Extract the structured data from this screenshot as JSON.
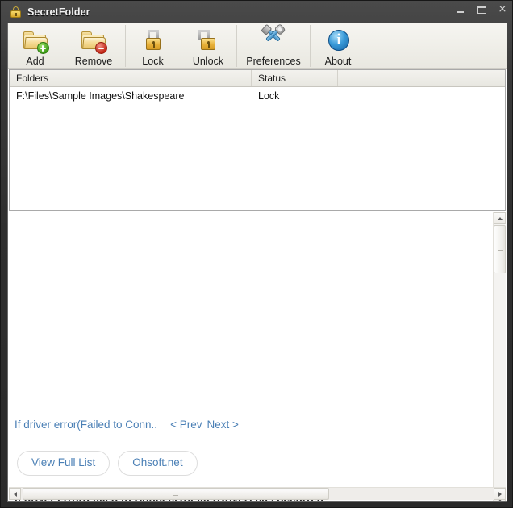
{
  "window": {
    "title": "SecretFolder",
    "lock_icon": "lock-icon",
    "controls": {
      "minimize": "minimize-icon",
      "maximize": "maximize-icon",
      "close": "×"
    }
  },
  "toolbar": {
    "buttons": [
      {
        "label": "Add",
        "icon": "folder-add-icon"
      },
      {
        "label": "Remove",
        "icon": "folder-remove-icon"
      },
      {
        "label": "Lock",
        "icon": "padlock-closed-icon"
      },
      {
        "label": "Unlock",
        "icon": "padlock-open-icon"
      },
      {
        "label": "Preferences",
        "icon": "tools-icon"
      },
      {
        "label": "About",
        "icon": "info-icon"
      }
    ]
  },
  "list": {
    "columns": [
      "Folders",
      "Status"
    ],
    "rows": [
      {
        "folder": "F:\\Files\\Sample Images\\Shakespeare",
        "status": "Lock"
      }
    ]
  },
  "content": {
    "notice_link": "If driver error(Failed to Conn..",
    "prev_link": "< Prev",
    "next_link": "Next >",
    "pills": [
      {
        "label": "View Full List"
      },
      {
        "label": "Ohsoft.net"
      }
    ],
    "error_text": "If driver error(Failed to ConnectToFilterDriver) has occurred"
  },
  "colors": {
    "link": "#4a7fb5",
    "titlebar_text": "#f2f2f2",
    "accent_folder": "#e9c66c",
    "accent_lock": "#e8b13a",
    "accent_info": "#3a9bd9"
  }
}
